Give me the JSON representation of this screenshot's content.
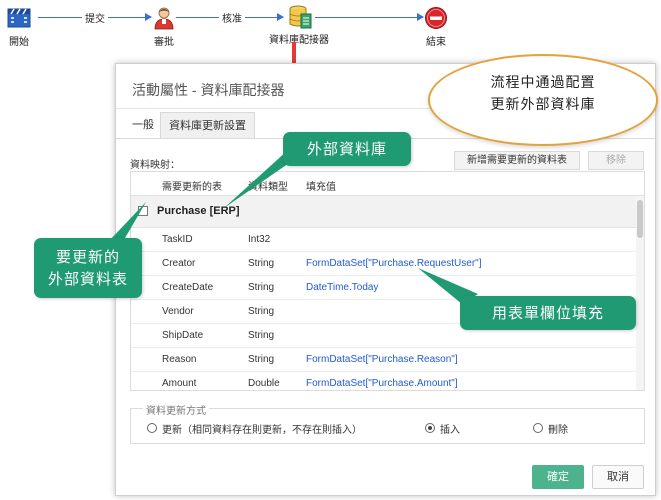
{
  "flow": {
    "nodes": [
      {
        "label": "開始",
        "icon": "clapperboard-icon"
      },
      {
        "label": "審批",
        "icon": "user-icon"
      },
      {
        "label": "資料庫配接器",
        "icon": "database-adapter-icon"
      },
      {
        "label": "結束",
        "icon": "stop-sign-icon"
      }
    ],
    "edges": [
      {
        "label": "提交"
      },
      {
        "label": "核准"
      }
    ]
  },
  "dialog": {
    "title": "活動屬性 - 資料庫配接器",
    "tabs": [
      {
        "label": "一般",
        "active": false
      },
      {
        "label": "資料庫更新設置",
        "active": true
      }
    ],
    "mapping_label": "資料映射：",
    "add_table_button": "新增需要更新的資料表",
    "remove_button": "移除",
    "columns": [
      "需要更新的表",
      "資料類型",
      "填充值"
    ],
    "group": "Purchase [ERP]",
    "rows": [
      {
        "field": "TaskID",
        "type": "Int32",
        "value": ""
      },
      {
        "field": "Creator",
        "type": "String",
        "value": "FormDataSet[\"Purchase.RequestUser\"]"
      },
      {
        "field": "CreateDate",
        "type": "String",
        "value": "DateTime.Today"
      },
      {
        "field": "Vendor",
        "type": "String",
        "value": ""
      },
      {
        "field": "ShipDate",
        "type": "String",
        "value": ""
      },
      {
        "field": "Reason",
        "type": "String",
        "value": "FormDataSet[\"Purchase.Reason\"]"
      },
      {
        "field": "Amount",
        "type": "Double",
        "value": "FormDataSet[\"Purchase.Amount\"]"
      }
    ],
    "update_mode": {
      "legend": "資料更新方式",
      "options": [
        {
          "label": "更新（相同資料存在則更新，不存在則插入）",
          "checked": false
        },
        {
          "label": "插入",
          "checked": true
        },
        {
          "label": "刪除",
          "checked": false
        }
      ]
    },
    "ok_button": "確定",
    "cancel_button": "取消"
  },
  "annotations": {
    "cloud_line1": "流程中通過配置",
    "cloud_line2": "更新外部資料庫",
    "external_db": "外部資料庫",
    "table_line1": "要更新的",
    "table_line2": "外部資料表",
    "fill_from_form": "用表單欄位填充"
  },
  "colors": {
    "flow_line": "#3a6fd8",
    "arrow_red": "#e53935",
    "callout_green": "#1f9a73",
    "cloud_border": "#e2a33a",
    "ok_button": "#4cb38d",
    "link_value": "#1f5bd0"
  }
}
